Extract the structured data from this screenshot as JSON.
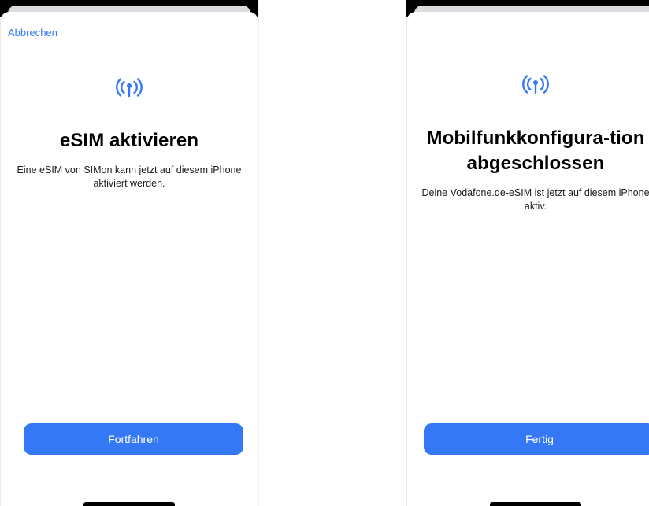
{
  "screens": [
    {
      "cancel_label": "Abbrechen",
      "icon": "antenna-radiowaves-icon",
      "title": "eSIM aktivieren",
      "description": "Eine eSIM von SIMon kann jetzt auf diesem iPhone aktiviert werden.",
      "button_label": "Fortfahren"
    },
    {
      "icon": "antenna-radiowaves-icon",
      "title": "Mobilfunkkonfigura-tion abgeschlossen",
      "description": "Deine Vodafone.de-eSIM ist jetzt auf diesem iPhone aktiv.",
      "button_label": "Fertig"
    }
  ],
  "colors": {
    "accent": "#3478f6",
    "background": "#ffffff",
    "text": "#000000"
  }
}
